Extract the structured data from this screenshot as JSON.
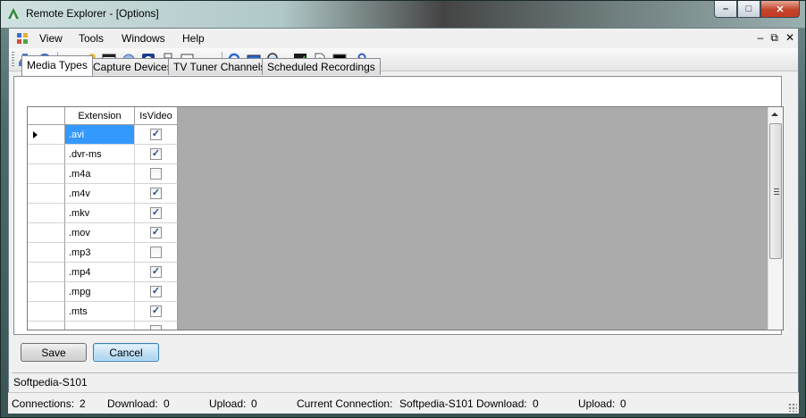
{
  "window": {
    "title": "Remote Explorer - [Options]",
    "minimize_glyph": "–",
    "maximize_glyph": "□",
    "close_glyph": "✕"
  },
  "menu": {
    "items": [
      "View",
      "Tools",
      "Windows",
      "Help"
    ],
    "mdi_minimize": "–",
    "mdi_restore": "⧉",
    "mdi_close": "✕"
  },
  "toolbar": {
    "icons": [
      "network-icon",
      "info-icon",
      "connect-icon",
      "settings-icon",
      "window-icon",
      "gear-icon",
      "media-icon",
      "print-icon",
      "monitor-dropdown-icon",
      "refresh-icon",
      "screen-icon",
      "zoom-dropdown-icon",
      "chart-icon",
      "document-icon",
      "console-icon",
      "tools-icon"
    ]
  },
  "tabs": [
    "Media Types",
    "Capture Devices",
    "TV Tuner Channels",
    "Scheduled Recordings"
  ],
  "grid": {
    "columns": [
      "Extension",
      "IsVideo"
    ],
    "rows": [
      {
        "extension": ".avi",
        "is_video": true
      },
      {
        "extension": ".dvr-ms",
        "is_video": true
      },
      {
        "extension": ".m4a",
        "is_video": false
      },
      {
        "extension": ".m4v",
        "is_video": true
      },
      {
        "extension": ".mkv",
        "is_video": true
      },
      {
        "extension": ".mov",
        "is_video": true
      },
      {
        "extension": ".mp3",
        "is_video": false
      },
      {
        "extension": ".mp4",
        "is_video": true
      },
      {
        "extension": ".mpg",
        "is_video": true
      },
      {
        "extension": ".mts",
        "is_video": true
      },
      {
        "extension": "",
        "is_video": false
      }
    ]
  },
  "buttons": {
    "save": "Save",
    "cancel": "Cancel"
  },
  "status": {
    "host": "Softpedia-S101"
  },
  "statusbar": {
    "connections_label": "Connections:",
    "connections_value": "2",
    "download_label": "Download:",
    "download_value": "0",
    "upload_label": "Upload:",
    "upload_value": "0",
    "current_label": "Current Connection:",
    "current_value": "Softpedia-S101",
    "current_download_label": "Download:",
    "current_download_value": "0",
    "current_upload_label": "Upload:",
    "current_upload_value": "0"
  }
}
